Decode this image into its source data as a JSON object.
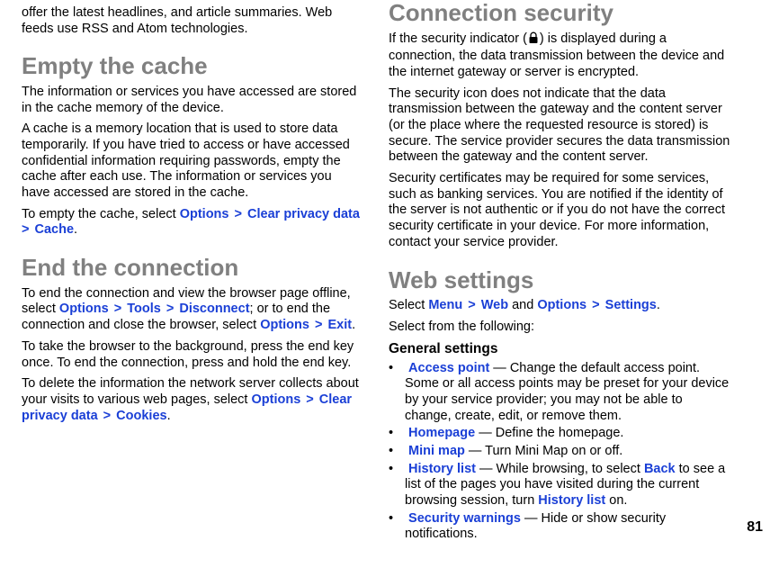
{
  "page_number": "81",
  "left": {
    "intro_frag": "offer the latest headlines, and article summaries. Web feeds use RSS and Atom technologies.",
    "h_cache": "Empty the cache",
    "cache_p1": "The information or services you have accessed are stored in the cache memory of the device.",
    "cache_p2": "A cache is a memory location that is used to store data temporarily. If you have tried to access or have accessed confidential information requiring passwords, empty the cache after each use. The information or services you have accessed are stored in the cache.",
    "cache_p3_a": "To empty the cache, select ",
    "cache_p3_opt": "Options",
    "cache_p3_sep1": " > ",
    "cache_p3_cpd": "Clear privacy data",
    "cache_p3_sep2": " > ",
    "cache_p3_cache": "Cache",
    "cache_p3_end": ".",
    "h_end": "End the connection",
    "end_p1_a": "To end the connection and view the browser page offline, select ",
    "end_p1_opt": "Options",
    "end_p1_s1": " > ",
    "end_p1_tools": "Tools",
    "end_p1_s2": " > ",
    "end_p1_disc": "Disconnect",
    "end_p1_mid": "; or to end the connection and close the browser, select ",
    "end_p1_opt2": "Options",
    "end_p1_s3": " > ",
    "end_p1_exit": "Exit",
    "end_p1_end": ".",
    "end_p2": "To take the browser to the background, press the end key once. To end the connection, press and hold the end key.",
    "end_p3_a": "To delete the information the network server collects about your visits to various web pages, select ",
    "end_p3_opt": "Options",
    "end_p3_s1": " > ",
    "end_p3_cpd": "Clear privacy data",
    "end_p3_s2": " > ",
    "end_p3_cookies": "Cookies",
    "end_p3_end": "."
  },
  "right": {
    "h_conn": "Connection security",
    "conn_p1_a": "If the security indicator (",
    "conn_p1_b": ") is displayed during a connection, the data transmission between the device and the internet gateway or server is encrypted.",
    "conn_p2": "The security icon does not indicate that the data transmission between the gateway and the content server (or the place where the requested resource is stored) is secure. The service provider secures the data transmission between the gateway and the content server.",
    "conn_p3": "Security certificates may be required for some services, such as banking services. You are notified if the identity of the server is not authentic or if you do not have the correct security certificate in your device. For more information, contact your service provider.",
    "h_web": "Web settings",
    "web_p1_a": "Select ",
    "web_p1_menu": "Menu",
    "web_p1_s1": " > ",
    "web_p1_web": "Web",
    "web_p1_and": " and ",
    "web_p1_opt": "Options",
    "web_p1_s2": " > ",
    "web_p1_settings": "Settings",
    "web_p1_end": ".",
    "web_p2": "Select from the following:",
    "sub_general": "General settings",
    "items": {
      "access_point": {
        "label": "Access point",
        "desc": " — Change the default access point. Some or all access points may be preset for your device by your service provider; you may not be able to change, create, edit, or remove them."
      },
      "homepage": {
        "label": "Homepage",
        "desc": " — Define the homepage."
      },
      "mini_map": {
        "label": "Mini map",
        "desc": " — Turn Mini Map on or off."
      },
      "history_list": {
        "label": "History list",
        "desc_a": " — While browsing, to select ",
        "back": "Back",
        "desc_b": " to see a list of the pages you have visited during the current browsing session, turn ",
        "hl2": "History list",
        "desc_c": " on."
      },
      "security_warnings": {
        "label": "Security warnings",
        "desc": " — Hide or show security notifications."
      }
    }
  }
}
